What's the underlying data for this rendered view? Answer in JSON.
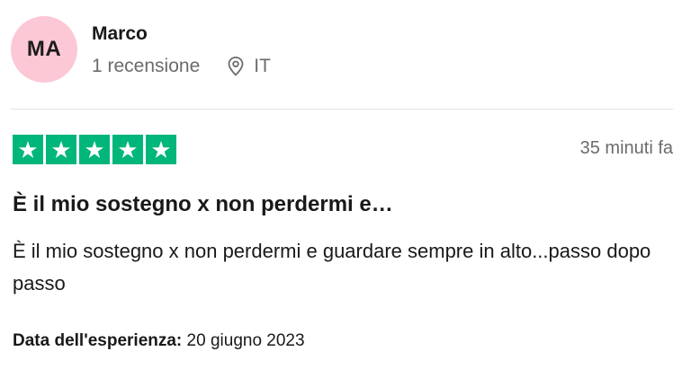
{
  "reviewer": {
    "initials": "MA",
    "name": "Marco",
    "reviews_count": "1 recensione",
    "country": "IT",
    "avatar_color": "#fcc8d6",
    "location_icon": "map-pin-icon"
  },
  "review": {
    "rating": 5,
    "star_color": "#00b67a",
    "time_ago": "35 minuti fa",
    "title": "È il mio sostegno x non perdermi e…",
    "body": "È il mio sostegno x non perdermi e guardare sempre in alto...passo dopo passo",
    "experience_label": "Data dell'esperienza:",
    "experience_date": "20 giugno 2023"
  }
}
